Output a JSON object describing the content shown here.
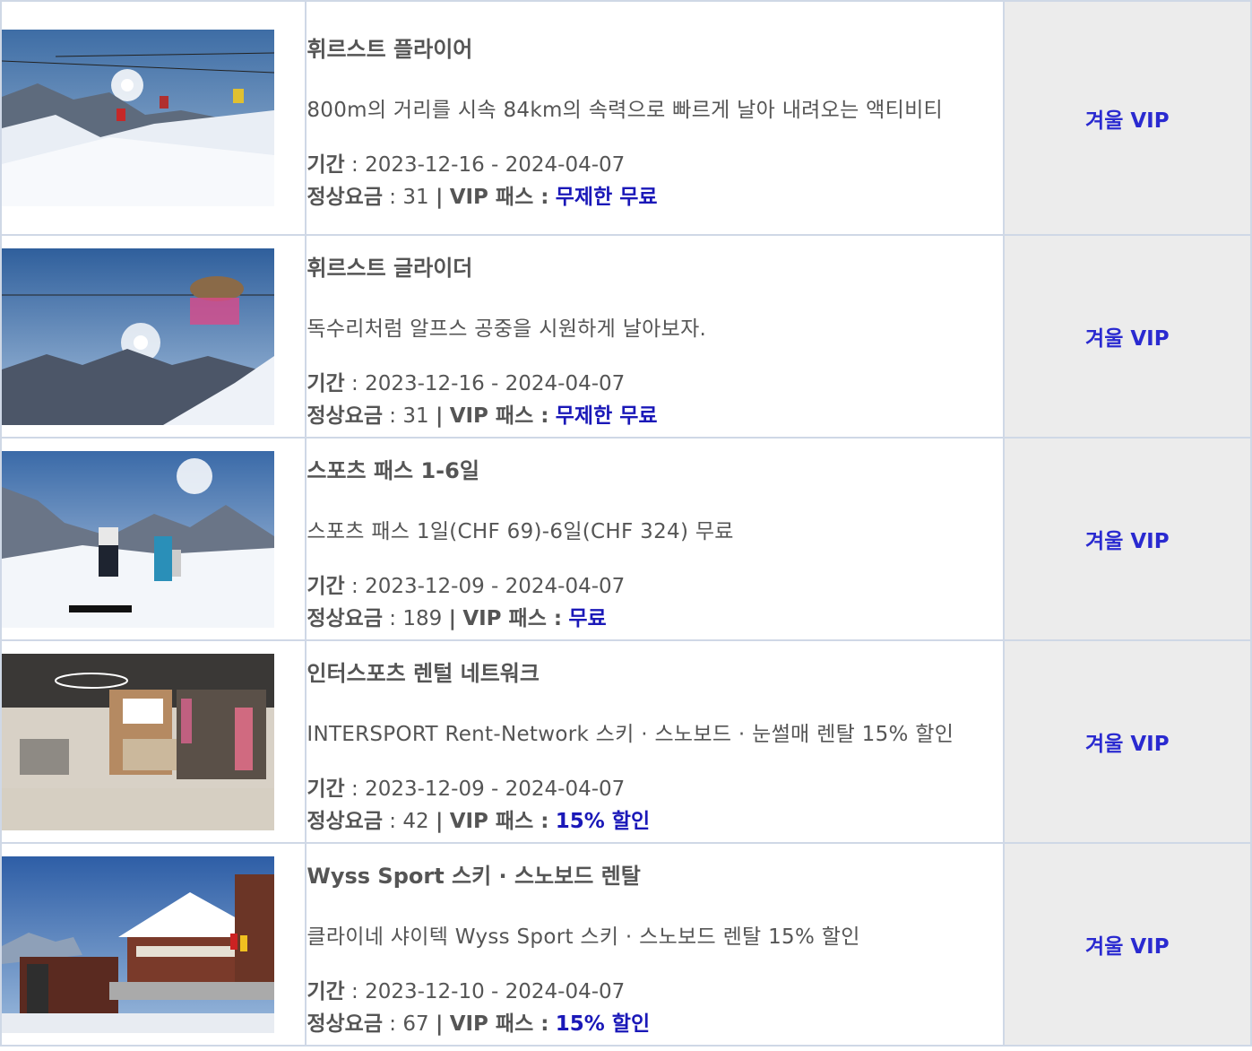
{
  "labels": {
    "period": "기간",
    "fee": "정상요금",
    "vip_pass": "VIP 패스 :"
  },
  "items": [
    {
      "title": "휘르스트 플라이어",
      "description": "800m의 거리를 시속 84km의 속력으로 빠르게 날아 내려오는 액티비티",
      "period": "2023-12-16 - 2024-04-07",
      "fee": "31",
      "benefit": "무제한 무료",
      "category": "겨울 VIP"
    },
    {
      "title": "휘르스트 글라이더",
      "description": "독수리처럼 알프스 공중을 시원하게 날아보자.",
      "period": "2023-12-16 - 2024-04-07",
      "fee": "31",
      "benefit": "무제한 무료",
      "category": "겨울 VIP"
    },
    {
      "title": "스포츠 패스 1-6일",
      "description": "스포츠 패스 1일(CHF 69)-6일(CHF 324) 무료",
      "period": "2023-12-09 - 2024-04-07",
      "fee": "189",
      "benefit": "무료",
      "category": "겨울 VIP"
    },
    {
      "title": "인터스포츠 렌털 네트워크",
      "description": "INTERSPORT Rent-Network 스키 · 스노보드 · 눈썰매 렌탈 15% 할인",
      "period": "2023-12-09 - 2024-04-07",
      "fee": "42",
      "benefit": "15% 할인",
      "category": "겨울 VIP"
    },
    {
      "title": "Wyss Sport 스키 · 스노보드 렌탈",
      "description": "클라이네 샤이텍 Wyss Sport 스키 · 스노보드 렌탈 15% 할인",
      "period": "2023-12-10 - 2024-04-07",
      "fee": "67",
      "benefit": "15% 할인",
      "category": "겨울 VIP"
    }
  ]
}
